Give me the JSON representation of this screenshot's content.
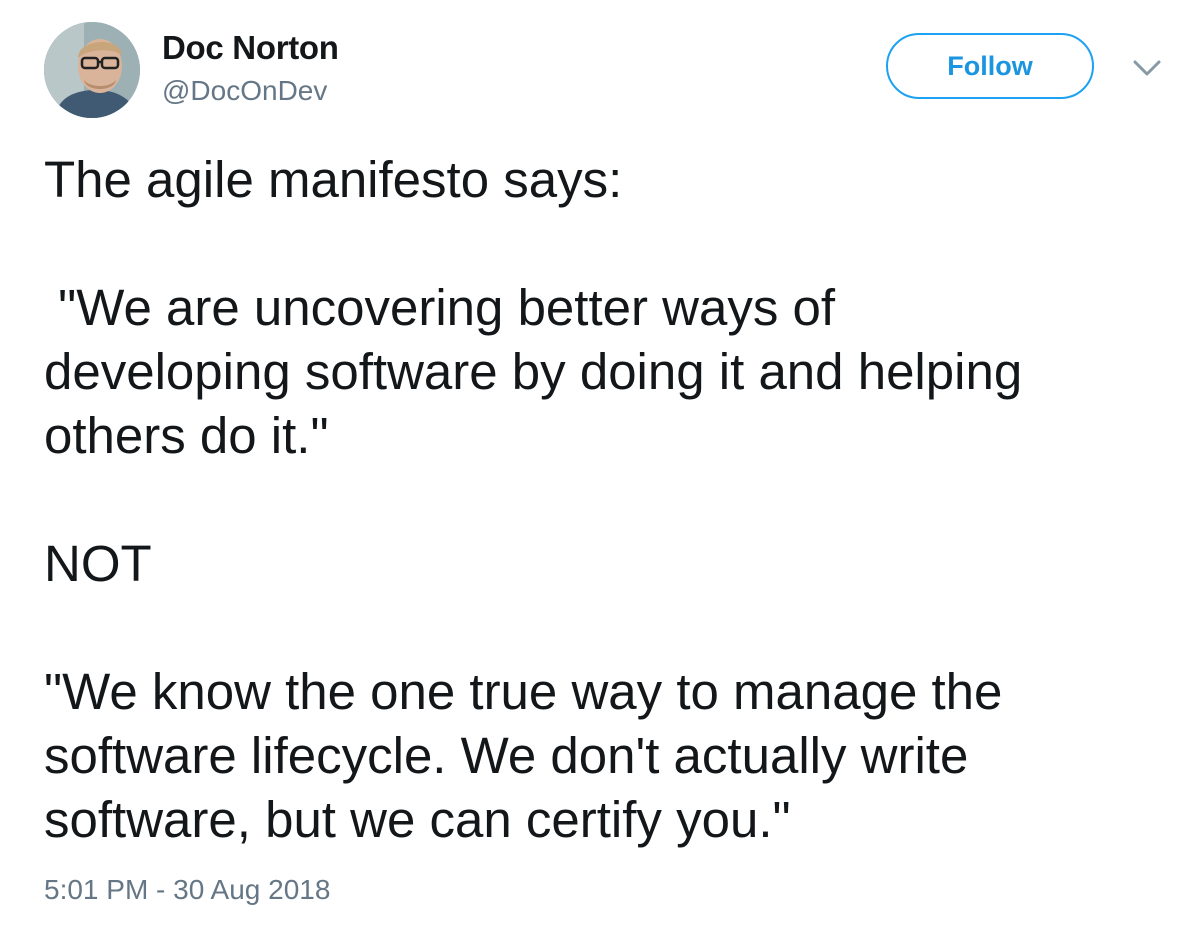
{
  "user": {
    "display_name": "Doc Norton",
    "handle": "@DocOnDev"
  },
  "follow_button": {
    "label": "Follow"
  },
  "tweet": {
    "lines": [
      "The agile manifesto says:",
      "",
      " \"We are uncovering better ways of",
      "developing software by doing it and helping",
      "others do it.\"",
      "",
      "NOT",
      "",
      "\"We know the one true way to manage the",
      "software lifecycle. We don't actually write",
      "software, but we can certify you.\""
    ],
    "timestamp": "5:01 PM - 30 Aug 2018"
  },
  "icons": {
    "avatar": "profile-photo",
    "menu": "chevron-down-icon"
  },
  "colors": {
    "accent": "#1da1f2",
    "text": "#14171a",
    "secondary_text": "#657786"
  }
}
